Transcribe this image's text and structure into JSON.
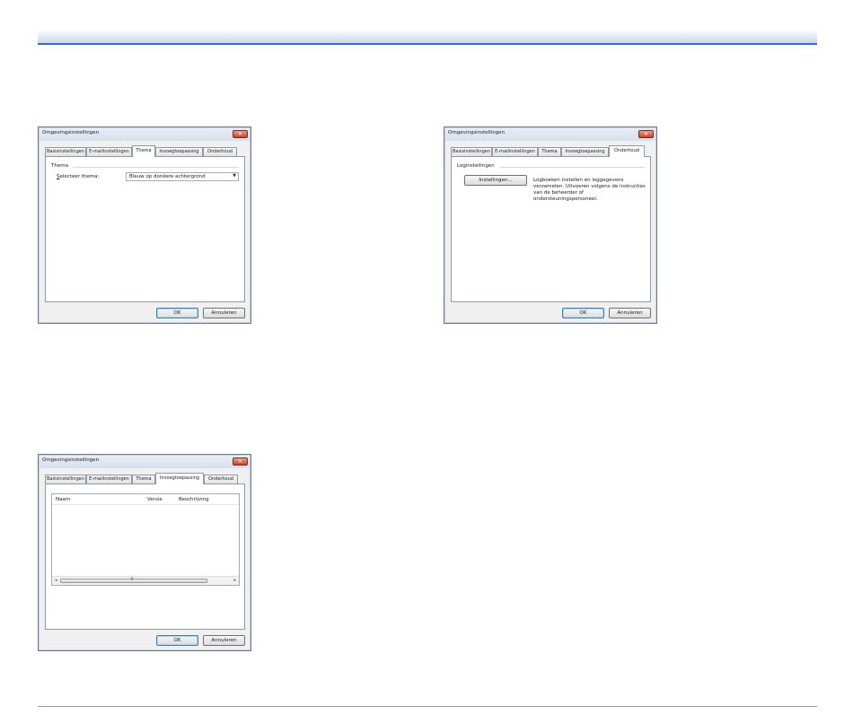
{
  "dialog_title": "Omgevingsinstellingen",
  "close_glyph": "✕",
  "tabs": {
    "basic": "Basisinstellingen",
    "email": "E-mailinstellingen",
    "theme": "Thema",
    "plugin": "Invoegtoepassing",
    "maintenance": "Onderhoud"
  },
  "buttons": {
    "ok": "OK",
    "cancel": "Annuleren"
  },
  "theme_page": {
    "group_label": "Thema",
    "select_label_accel": "S",
    "select_label_rest": "electeer thema:",
    "select_value": "Blauw op donkere achtergrond",
    "select_arrow": "▼"
  },
  "maintenance_page": {
    "group_label": "Loginstellingen",
    "settings_button": "Instellingen...",
    "description_lines": [
      "Logboeken instellen en loggegevens",
      "verzamelen. Uitvoeren volgens de instructies",
      "van de beheerder of",
      "ondersteuningspersoneel."
    ]
  },
  "plugin_page": {
    "columns": {
      "name": "Naam",
      "version": "Versie",
      "description": "Beschrijving"
    },
    "scroll_left": "◂",
    "scroll_right": "▸",
    "scroll_grip": "⦀"
  }
}
